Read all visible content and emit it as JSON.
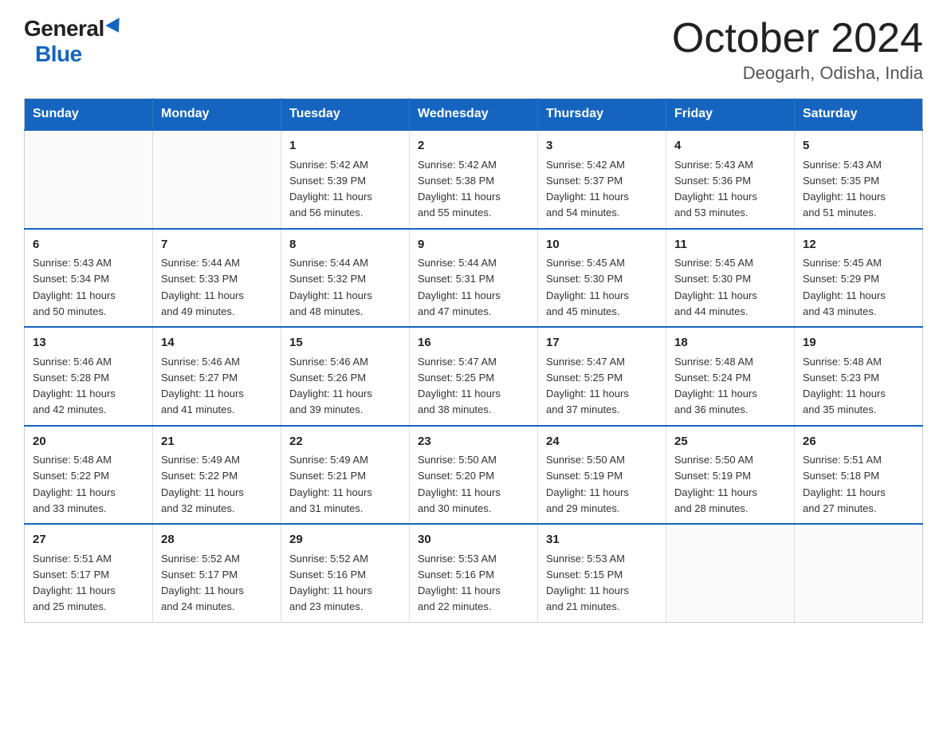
{
  "header": {
    "logo_general": "General",
    "logo_blue": "Blue",
    "title": "October 2024",
    "subtitle": "Deogarh, Odisha, India"
  },
  "days_of_week": [
    "Sunday",
    "Monday",
    "Tuesday",
    "Wednesday",
    "Thursday",
    "Friday",
    "Saturday"
  ],
  "weeks": [
    [
      {
        "day": "",
        "info": ""
      },
      {
        "day": "",
        "info": ""
      },
      {
        "day": "1",
        "info": "Sunrise: 5:42 AM\nSunset: 5:39 PM\nDaylight: 11 hours\nand 56 minutes."
      },
      {
        "day": "2",
        "info": "Sunrise: 5:42 AM\nSunset: 5:38 PM\nDaylight: 11 hours\nand 55 minutes."
      },
      {
        "day": "3",
        "info": "Sunrise: 5:42 AM\nSunset: 5:37 PM\nDaylight: 11 hours\nand 54 minutes."
      },
      {
        "day": "4",
        "info": "Sunrise: 5:43 AM\nSunset: 5:36 PM\nDaylight: 11 hours\nand 53 minutes."
      },
      {
        "day": "5",
        "info": "Sunrise: 5:43 AM\nSunset: 5:35 PM\nDaylight: 11 hours\nand 51 minutes."
      }
    ],
    [
      {
        "day": "6",
        "info": "Sunrise: 5:43 AM\nSunset: 5:34 PM\nDaylight: 11 hours\nand 50 minutes."
      },
      {
        "day": "7",
        "info": "Sunrise: 5:44 AM\nSunset: 5:33 PM\nDaylight: 11 hours\nand 49 minutes."
      },
      {
        "day": "8",
        "info": "Sunrise: 5:44 AM\nSunset: 5:32 PM\nDaylight: 11 hours\nand 48 minutes."
      },
      {
        "day": "9",
        "info": "Sunrise: 5:44 AM\nSunset: 5:31 PM\nDaylight: 11 hours\nand 47 minutes."
      },
      {
        "day": "10",
        "info": "Sunrise: 5:45 AM\nSunset: 5:30 PM\nDaylight: 11 hours\nand 45 minutes."
      },
      {
        "day": "11",
        "info": "Sunrise: 5:45 AM\nSunset: 5:30 PM\nDaylight: 11 hours\nand 44 minutes."
      },
      {
        "day": "12",
        "info": "Sunrise: 5:45 AM\nSunset: 5:29 PM\nDaylight: 11 hours\nand 43 minutes."
      }
    ],
    [
      {
        "day": "13",
        "info": "Sunrise: 5:46 AM\nSunset: 5:28 PM\nDaylight: 11 hours\nand 42 minutes."
      },
      {
        "day": "14",
        "info": "Sunrise: 5:46 AM\nSunset: 5:27 PM\nDaylight: 11 hours\nand 41 minutes."
      },
      {
        "day": "15",
        "info": "Sunrise: 5:46 AM\nSunset: 5:26 PM\nDaylight: 11 hours\nand 39 minutes."
      },
      {
        "day": "16",
        "info": "Sunrise: 5:47 AM\nSunset: 5:25 PM\nDaylight: 11 hours\nand 38 minutes."
      },
      {
        "day": "17",
        "info": "Sunrise: 5:47 AM\nSunset: 5:25 PM\nDaylight: 11 hours\nand 37 minutes."
      },
      {
        "day": "18",
        "info": "Sunrise: 5:48 AM\nSunset: 5:24 PM\nDaylight: 11 hours\nand 36 minutes."
      },
      {
        "day": "19",
        "info": "Sunrise: 5:48 AM\nSunset: 5:23 PM\nDaylight: 11 hours\nand 35 minutes."
      }
    ],
    [
      {
        "day": "20",
        "info": "Sunrise: 5:48 AM\nSunset: 5:22 PM\nDaylight: 11 hours\nand 33 minutes."
      },
      {
        "day": "21",
        "info": "Sunrise: 5:49 AM\nSunset: 5:22 PM\nDaylight: 11 hours\nand 32 minutes."
      },
      {
        "day": "22",
        "info": "Sunrise: 5:49 AM\nSunset: 5:21 PM\nDaylight: 11 hours\nand 31 minutes."
      },
      {
        "day": "23",
        "info": "Sunrise: 5:50 AM\nSunset: 5:20 PM\nDaylight: 11 hours\nand 30 minutes."
      },
      {
        "day": "24",
        "info": "Sunrise: 5:50 AM\nSunset: 5:19 PM\nDaylight: 11 hours\nand 29 minutes."
      },
      {
        "day": "25",
        "info": "Sunrise: 5:50 AM\nSunset: 5:19 PM\nDaylight: 11 hours\nand 28 minutes."
      },
      {
        "day": "26",
        "info": "Sunrise: 5:51 AM\nSunset: 5:18 PM\nDaylight: 11 hours\nand 27 minutes."
      }
    ],
    [
      {
        "day": "27",
        "info": "Sunrise: 5:51 AM\nSunset: 5:17 PM\nDaylight: 11 hours\nand 25 minutes."
      },
      {
        "day": "28",
        "info": "Sunrise: 5:52 AM\nSunset: 5:17 PM\nDaylight: 11 hours\nand 24 minutes."
      },
      {
        "day": "29",
        "info": "Sunrise: 5:52 AM\nSunset: 5:16 PM\nDaylight: 11 hours\nand 23 minutes."
      },
      {
        "day": "30",
        "info": "Sunrise: 5:53 AM\nSunset: 5:16 PM\nDaylight: 11 hours\nand 22 minutes."
      },
      {
        "day": "31",
        "info": "Sunrise: 5:53 AM\nSunset: 5:15 PM\nDaylight: 11 hours\nand 21 minutes."
      },
      {
        "day": "",
        "info": ""
      },
      {
        "day": "",
        "info": ""
      }
    ]
  ]
}
